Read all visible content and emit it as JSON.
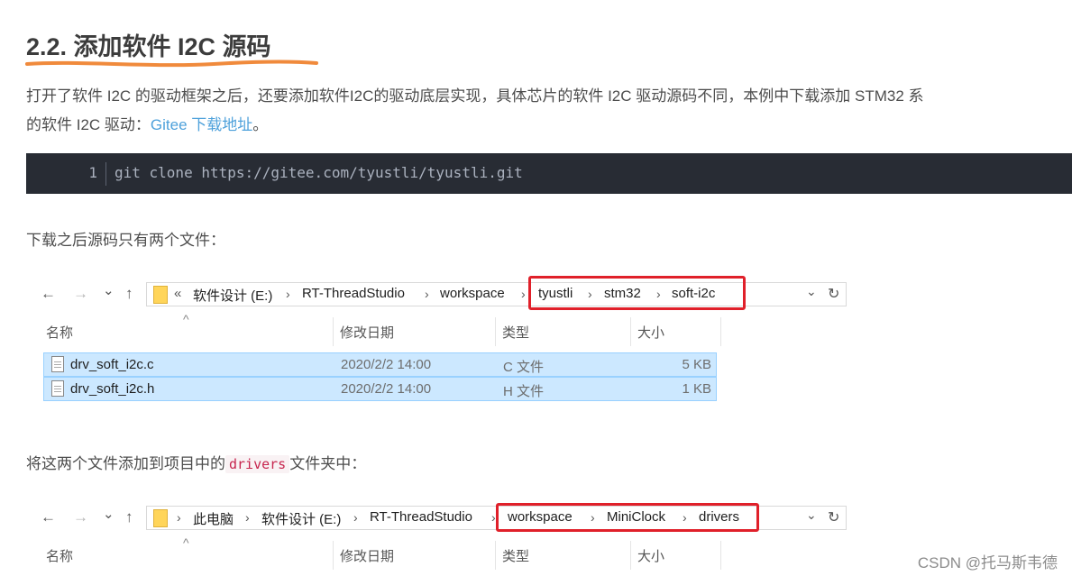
{
  "article": {
    "heading": "2.2. 添加软件 I2C 源码",
    "para1_line1": "打开了软件 I2C 的驱动框架之后，还要添加软件I2C的驱动底层实现，具体芯片的软件 I2C 驱动源码不同，本例中下载添加 STM32 系",
    "para1_line2_prefix": "的软件 I2C 驱动：",
    "para1_link": "Gitee 下载地址",
    "para1_line2_suffix": "。",
    "code_line_number": "1",
    "code": "git clone https://gitee.com/tyustli/tyustli.git",
    "para2": "下载之后源码只有两个文件：",
    "para3_prefix": "将这两个文件添加到项目中的",
    "para3_code": "drivers",
    "para3_suffix": "文件夹中："
  },
  "explorer1": {
    "back": "←",
    "forward": "→",
    "recent": "⌄",
    "up": "↑",
    "overflow": "«",
    "crumbs": [
      "软件设计 (E:)",
      "RT-ThreadStudio",
      "workspace",
      "tyustli",
      "stm32",
      "soft-i2c"
    ],
    "separator": "›",
    "dropdown": "⌄",
    "refresh": "↻",
    "sort_indicator": "^",
    "columns": [
      "名称",
      "修改日期",
      "类型",
      "大小"
    ],
    "files": [
      {
        "name": "drv_soft_i2c.c",
        "date": "2020/2/2 14:00",
        "type": "C 文件",
        "size": "5 KB"
      },
      {
        "name": "drv_soft_i2c.h",
        "date": "2020/2/2 14:00",
        "type": "H 文件",
        "size": "1 KB"
      }
    ]
  },
  "explorer2": {
    "back": "←",
    "forward": "→",
    "recent": "⌄",
    "up": "↑",
    "overflow": "›",
    "crumbs": [
      "此电脑",
      "软件设计 (E:)",
      "RT-ThreadStudio",
      "workspace",
      "MiniClock",
      "drivers"
    ],
    "separator": "›",
    "dropdown": "⌄",
    "refresh": "↻",
    "sort_indicator": "^",
    "columns": [
      "名称",
      "修改日期",
      "类型",
      "大小"
    ]
  },
  "watermark": "CSDN @托马斯韦德",
  "colors": {
    "link": "#4ea1db",
    "underline": "#f08a3c",
    "highlight_box": "#e0202a",
    "selection": "#cce8ff",
    "code_bg": "#282c34"
  }
}
